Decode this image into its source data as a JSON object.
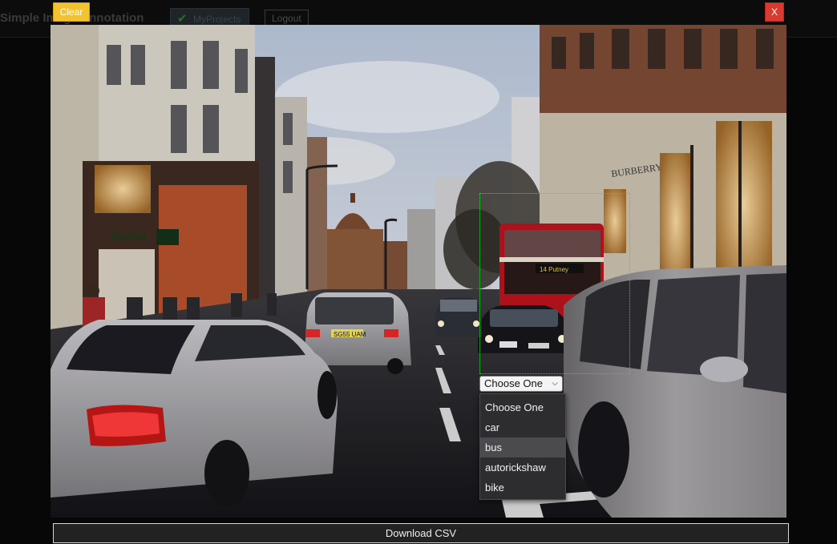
{
  "app": {
    "title": "Simple Image Annotation",
    "nav_projects_label": "MyProjects",
    "nav_logout_label": "Logout",
    "check_icon": "checkmark-icon"
  },
  "toolbar": {
    "clear_label": "Clear",
    "close_label": "X",
    "download_label": "Download CSV"
  },
  "annotation": {
    "box_color": "#3fd24a",
    "selected_label": "Choose One",
    "options": [
      "Choose One",
      "car",
      "bus",
      "autorickshaw",
      "bike"
    ],
    "highlighted_option": "bus"
  },
  "photo": {
    "signs": {
      "shop_sign": "Kipling",
      "store_sign": "BURBERRY",
      "plate_taxi": "SG55 UAM",
      "bus_dest": "14 Putney"
    }
  }
}
